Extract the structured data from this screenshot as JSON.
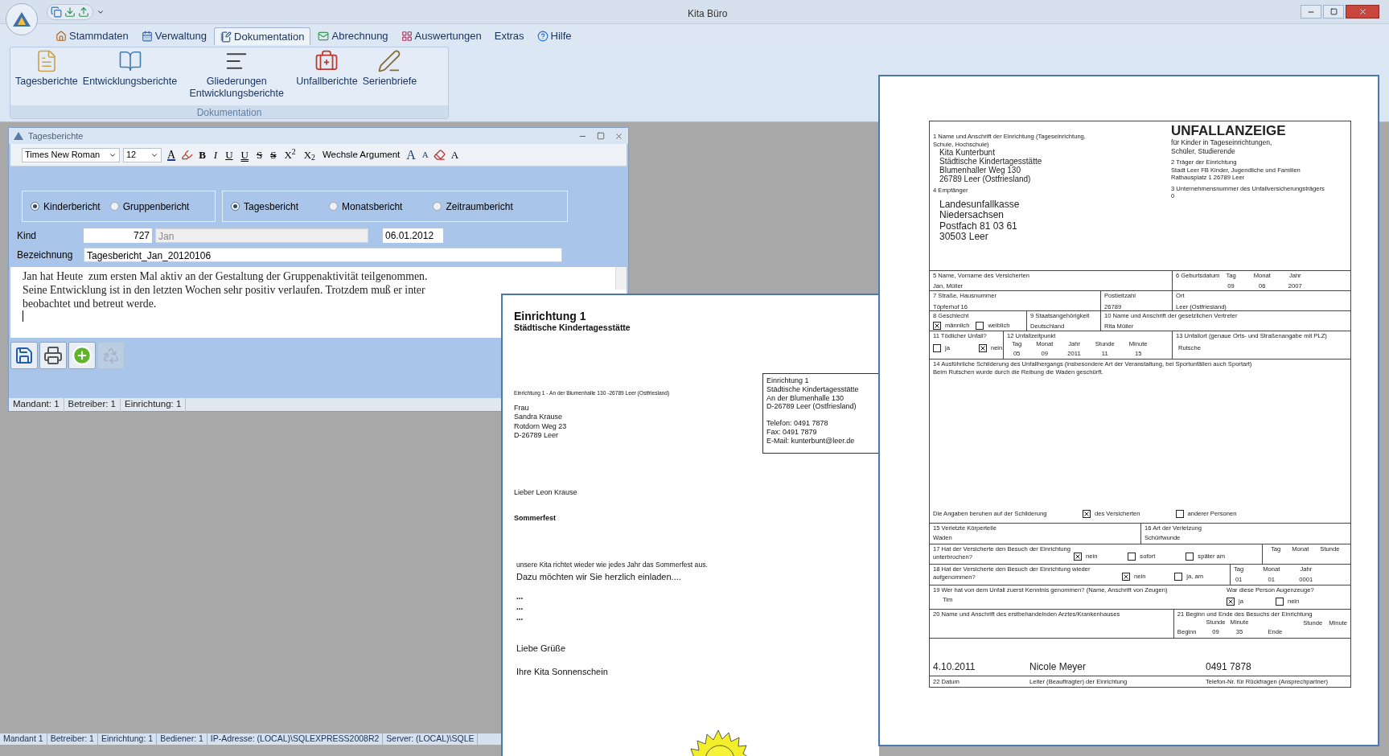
{
  "window": {
    "title": "Kita Büro"
  },
  "menu_tabs": [
    {
      "label": "Stammdaten",
      "selected": false
    },
    {
      "label": "Verwaltung",
      "selected": false
    },
    {
      "label": "Dokumentation",
      "selected": true
    },
    {
      "label": "Abrechnung",
      "selected": false
    },
    {
      "label": "Auswertungen",
      "selected": false
    },
    {
      "label": "Extras",
      "selected": false
    },
    {
      "label": "Hilfe",
      "selected": false
    }
  ],
  "ribbon": {
    "group_label": "Dokumentation",
    "buttons": [
      {
        "label": "Tagesberichte"
      },
      {
        "label": "Entwicklungsberichte"
      },
      {
        "label": "Gliederungen Entwicklungsberichte"
      },
      {
        "label": "Unfallberichte"
      },
      {
        "label": "Serienbriefe"
      }
    ]
  },
  "daily_report": {
    "title": "Tagesberichte",
    "toolbar": [
      {
        "kind": "dropdown",
        "text": "Times New Roman"
      },
      {
        "kind": "dropdown",
        "text": "12"
      },
      {
        "kind": "color",
        "text": "A"
      },
      {
        "kind": "highlight"
      },
      {
        "kind": "bold",
        "text": "B"
      },
      {
        "kind": "italic",
        "text": "I"
      },
      {
        "kind": "underline",
        "text": "U"
      },
      {
        "kind": "double-underline",
        "text": "U"
      },
      {
        "kind": "strike",
        "text": "S"
      },
      {
        "kind": "double-strike",
        "text": "S"
      },
      {
        "kind": "plain",
        "text": "X$^{2}$"
      },
      {
        "kind": "plain",
        "text": "X$_{2}$"
      },
      {
        "kind": "menu",
        "text": "Wechsle Argument"
      },
      {
        "kind": "grow",
        "text": "A"
      },
      {
        "kind": "shrink",
        "text": "A"
      },
      {
        "kind": "eraser"
      },
      {
        "kind": "plain",
        "text": "A"
      }
    ],
    "report_type": [
      {
        "label": "Kinderbericht",
        "selected": true
      },
      {
        "label": "Gruppenbericht",
        "selected": false
      }
    ],
    "period": [
      {
        "label": "Tagesbericht",
        "selected": true
      },
      {
        "label": "Monatsbericht",
        "selected": false
      },
      {
        "label": "Zeitraumbericht",
        "selected": false
      }
    ],
    "child_label": "Kind",
    "child_number": "727",
    "child_name": "Jan",
    "date": "06.01.2012",
    "name_label": "Bezeichnung",
    "name_value": "Tagesbericht_Jan_20120106",
    "text_lines": [
      "Jan hat Heute  zum ersten Mal aktiv an der Gestaltung der Gruppenaktivität teilgenommen.",
      "Seine Entwicklung ist in den letzten Wochen sehr positiv verlaufen. Trotzdem muß er inter",
      "beobachtet und betreut werde."
    ],
    "actions": [
      {
        "kind": "save",
        "disabled": false
      },
      {
        "kind": "print",
        "disabled": false
      },
      {
        "kind": "add",
        "disabled": false
      },
      {
        "kind": "recycle",
        "disabled": true
      }
    ],
    "status": [
      "Mandant: 1",
      "Betreiber: 1",
      "Einrichtung: 1"
    ]
  },
  "status_bar": [
    "Mandant 1",
    "Betreiber: 1",
    "Einrichtung: 1",
    "Bediener: 1",
    "IP-Adresse: (LOCAL)\\SQLEXPRESS2008R2",
    "Server: (LOCAL)\\SQLE"
  ],
  "letter": {
    "heading": "Einrichtung 1",
    "subheading": "Städtische Kindertagesstätte",
    "sender_line": "Einrichtung 1 - An der Blumenhalle 130 -26789 Leer (Ostfriesland)",
    "recipient": [
      "Frau",
      "Sandra Krause",
      "Rotdorn Weg 23",
      "D-26789 Leer"
    ],
    "contact_address": [
      "Einrichtung 1",
      "Städtische Kindertagesstätte",
      "An der Blumenhalle 130",
      "D-26789 Leer (Ostfriesland)"
    ],
    "contact_phone": [
      "Telefon: 0491 7878",
      "Fax: 0491 7879",
      "E-Mail: kunterbunt@leer.de"
    ],
    "salutation": "Lieber Leon Krause",
    "subject": "Sommerfest",
    "body_intro": "unsere Kita richtet wieder wie jedes Jahr das Sommerfest aus.",
    "body": "Dazu möchten wir Sie herzlich einladen....",
    "ellipses": [
      "...",
      "...",
      "..."
    ],
    "closing": "Liebe Grüße",
    "signature": "Ihre Kita Sonnenschein"
  },
  "accident_report": {
    "title": "UNFALLANZEIGE",
    "subtitle": [
      "für Kinder in Tageseinrichtungen,",
      "Schüler, Studierende"
    ],
    "institution": {
      "label": "1 Name und Anschrift der Einrichtung (Tageseinrichtung, Schule, Hochschule)",
      "lines": [
        "Kita Kunterbunt",
        "Städtische Kindertagesstätte",
        "Blumenhaller Weg 130",
        "26789 Leer (Ostfriesland)"
      ]
    },
    "recipient": {
      "label": "4 Empfänger",
      "lines": [
        "Landesunfallkasse",
        "Niedersachsen",
        "Postfach 81 03 61",
        "30503 Leer"
      ]
    },
    "carrier": {
      "label": "2 Träger der Einrichtung",
      "lines": [
        "Stadt Leer FB Kinder, Jugendliche und Familien",
        "Rathausplatz 1 26789 Leer"
      ]
    },
    "company_number": {
      "label": "3 Unternehmensnummer des Unfallversicherungsträgers",
      "value": "0"
    },
    "name": {
      "label": "5 Name, Vorname des Versicherten",
      "value": "Jan, Müller"
    },
    "birth_date": {
      "label": "6 Geburtsdatum",
      "parts": [
        {
          "label": "Tag",
          "value": "09"
        },
        {
          "label": "Monat",
          "value": "06"
        },
        {
          "label": "Jahr",
          "value": "2007"
        }
      ]
    },
    "street": {
      "label": "7 Straße, Hausnummer",
      "value": "Töpferhof 16"
    },
    "postcode": {
      "label": "Postleitzahl",
      "value": "26789"
    },
    "city": {
      "label": "Ort",
      "value": "Leer (Ostfriesland)"
    },
    "sex": {
      "label": "8 Geschlecht",
      "options": [
        {
          "label": "männlich",
          "checked": true
        },
        {
          "label": "weiblich",
          "checked": false
        }
      ]
    },
    "nationality": {
      "label": "9 Staatsangehörigkeit",
      "value": "Deutschland"
    },
    "guardian": {
      "label": "10 Name und Anschrift der gesetzlichen Vertreter",
      "value": "Rita Müller"
    },
    "fatal": {
      "label": "11 Tödlicher Unfall?",
      "options": [
        {
          "label": "ja",
          "checked": false
        },
        {
          "label": "nein",
          "checked": true
        }
      ]
    },
    "accident_time": {
      "label": "12 Unfallzeitpunkt",
      "parts": [
        {
          "label": "Tag",
          "value": "05"
        },
        {
          "label": "Monat",
          "value": "09"
        },
        {
          "label": "Jahr",
          "value": "2011"
        },
        {
          "label": "Stunde",
          "value": "11"
        },
        {
          "label": "Minute",
          "value": "15"
        }
      ]
    },
    "accident_place": {
      "label": "13 Unfallort (genaue Orts- und Straßenangabe mit PLZ)",
      "value": "Rutsche"
    },
    "description": {
      "label": "14 Ausführliche Schilderung des Unfallhergangs (insbesondere Art der Veranstaltung, bei Sportunfällen auch Sportart)",
      "value": "Beim Rutschen wurde durch die Reibung die Waden geschürft."
    },
    "source": {
      "label": "Die Angaben beruhen auf der Schilderung",
      "options": [
        {
          "label": "des Versicherten",
          "checked": true
        },
        {
          "label": "anderer Personen",
          "checked": false
        }
      ]
    },
    "body_parts": {
      "label": "15 Verletzte Körperteile",
      "value": "Waden"
    },
    "injury": {
      "label": "16 Art der Verletzung",
      "value": "Schürfwunde"
    },
    "interrupted": {
      "label": "17 Hat der Versicherte den Besuch der Einrichtung unterbrochen?",
      "options": [
        {
          "label": "nein",
          "checked": true
        },
        {
          "label": "sofort",
          "checked": false
        },
        {
          "label": "später am",
          "checked": false
        }
      ],
      "parts": [
        {
          "label": "Tag"
        },
        {
          "label": "Monat"
        },
        {
          "label": "Stunde"
        }
      ]
    },
    "resumed": {
      "label": "18 Hat der Versicherte den Besuch der Einrichtung wieder aufgenommen?",
      "options": [
        {
          "label": "nein",
          "checked": true
        },
        {
          "label": "ja, am",
          "checked": false
        }
      ],
      "parts": [
        {
          "label": "Tag",
          "value": "01"
        },
        {
          "label": "Monat",
          "value": "01"
        },
        {
          "label": "Jahr",
          "value": "0001"
        }
      ]
    },
    "witness": {
      "label": "19 Wer hat von dem Unfall zuerst Kenntnis genommen? (Name, Anschrift von Zeugen)",
      "value": "Tim",
      "question": "War diese Person Augenzeuge?",
      "options": [
        {
          "label": "ja",
          "checked": true
        },
        {
          "label": "nein",
          "checked": false
        }
      ]
    },
    "doctor": {
      "label": "20 Name und Anschrift des erstbehandelnden Arztes/Krankenhauses"
    },
    "attendance": {
      "label": "21 Beginn und Ende des Besuchs der Einrichtung",
      "begin": {
        "label": "Beginn",
        "parts": [
          {
            "label": "Stunde",
            "value": "09"
          },
          {
            "label": "Minute",
            "value": "35"
          }
        ]
      },
      "end": {
        "label": "Ende",
        "parts": [
          {
            "label": "Stunde"
          },
          {
            "label": "Minute"
          }
        ]
      }
    },
    "signature": [
      {
        "value": "4.10.2011",
        "label": "22 Datum"
      },
      {
        "value": "Nicole Meyer",
        "label": "Leiter (Beauftragter) der Einrichtung"
      },
      {
        "value": "0491 7878",
        "label": "Telefon-Nr. für Rückfragen (Ansprechpartner)"
      }
    ]
  }
}
